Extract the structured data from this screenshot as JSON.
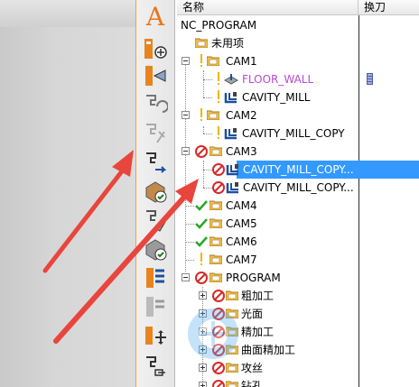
{
  "navigator": {
    "columns": {
      "name": "名称",
      "tool": "换刀"
    },
    "rows": [
      {
        "id": "nc_program",
        "label": "NC_PROGRAM"
      },
      {
        "id": "unused",
        "label": "未用项"
      },
      {
        "id": "cam1",
        "label": "CAM1"
      },
      {
        "id": "floor_wall",
        "label": "FLOOR_WALL"
      },
      {
        "id": "cavity_mill",
        "label": "CAVITY_MILL"
      },
      {
        "id": "cam2",
        "label": "CAM2"
      },
      {
        "id": "cavity_mill_copy",
        "label": "CAVITY_MILL_COPY"
      },
      {
        "id": "cam3",
        "label": "CAM3"
      },
      {
        "id": "cavity_mill_copy_1",
        "label": "CAVITY_MILL_COPY..."
      },
      {
        "id": "cavity_mill_copy_2",
        "label": "CAVITY_MILL_COPY..."
      },
      {
        "id": "cam4",
        "label": "CAM4"
      },
      {
        "id": "cam5",
        "label": "CAM5"
      },
      {
        "id": "cam6",
        "label": "CAM6"
      },
      {
        "id": "cam7",
        "label": "CAM7"
      },
      {
        "id": "program",
        "label": "PROGRAM"
      },
      {
        "id": "rough",
        "label": "粗加工"
      },
      {
        "id": "smooth",
        "label": "光面"
      },
      {
        "id": "finish",
        "label": "精加工"
      },
      {
        "id": "surface_finish",
        "label": "曲面精加工"
      },
      {
        "id": "tap",
        "label": "攻丝"
      },
      {
        "id": "drill",
        "label": "钻孔"
      }
    ]
  },
  "toolbar": {
    "items": [
      "text-A-icon",
      "create-program-icon",
      "create-tool-icon",
      "create-geometry-icon",
      "create-method-icon",
      "create-operation-icon",
      "geometry-view-icon",
      "tool-view-icon",
      "machine-view-icon",
      "operation-icon",
      "program-order-icon",
      "post-process-icon",
      "shop-docs-icon"
    ]
  },
  "colors": {
    "selection": "#3399ff",
    "arrow": "#e8453c",
    "accent_orange": "#f1a04a",
    "link_purple": "#b64bd1"
  }
}
